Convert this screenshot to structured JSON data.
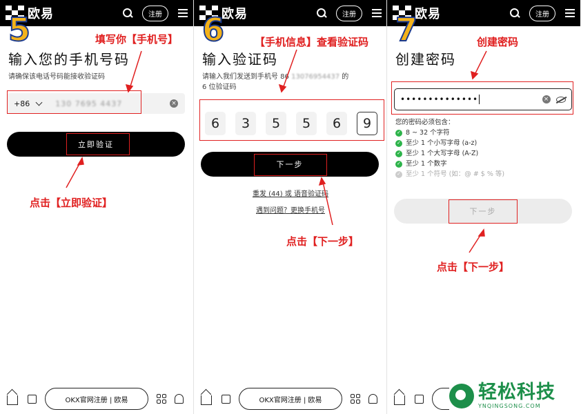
{
  "brand": {
    "name": "欧易"
  },
  "topbar": {
    "register": "注册"
  },
  "bottombar": {
    "url_label": "OKX官网注册 | 欧易"
  },
  "panel5": {
    "step": "5",
    "title": "输入您的手机号码",
    "subtitle": "请确保该电话号码能接收验证码",
    "country_code": "+86",
    "phone_value": "130 7695 4437",
    "verify_button": "立即验证",
    "annot_top": "填写你【手机号】",
    "annot_bottom": "点击【立即验证】"
  },
  "panel6": {
    "step": "6",
    "title": "输入验证码",
    "subtitle_pre": "请输入我们发送到手机号 86",
    "subtitle_num": "13076954437",
    "subtitle_post": "的",
    "subtitle_line2": "6 位验证码",
    "code_digits": [
      "6",
      "3",
      "5",
      "5",
      "6",
      "9"
    ],
    "next_button": "下一步",
    "resend": "重发 (44) 或 语音验证码",
    "help_link": "遇到问题？更换手机号",
    "annot_top": "【手机信息】查看验证码",
    "annot_bottom": "点击【下一步】"
  },
  "panel7": {
    "step": "7",
    "title": "创建密码",
    "password_mask": "••••••••••••••",
    "rules_header": "您的密码必须包含：",
    "rules": [
      {
        "text": "8 ~ 32 个字符",
        "met": true
      },
      {
        "text": "至少 1 个小写字母 (a-z)",
        "met": true
      },
      {
        "text": "至少 1 个大写字母 (A-Z)",
        "met": true
      },
      {
        "text": "至少 1 个数字",
        "met": true
      },
      {
        "text": "至少 1 个符号 (如：@ # $ % 等)",
        "met": false
      }
    ],
    "next_button": "下一步",
    "annot_top": "创建密码",
    "annot_bottom": "点击【下一步】"
  },
  "watermark": {
    "cn": "轻松科技",
    "en": "YNQINGSONG.COM"
  },
  "colors": {
    "accent": "#e02020",
    "check": "#2db34a",
    "step": "#f3b21a",
    "watermark": "#1d8f4a"
  }
}
